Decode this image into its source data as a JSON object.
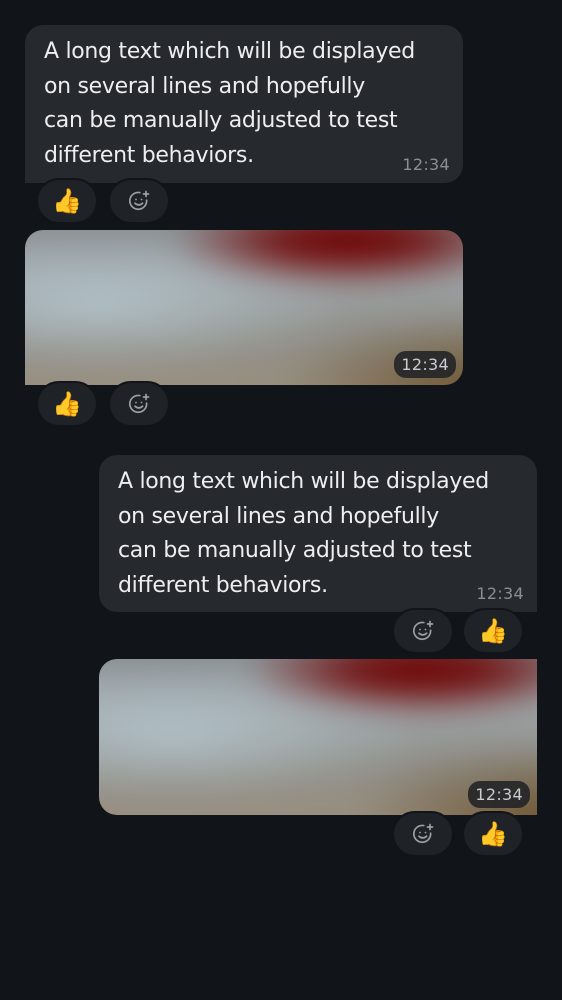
{
  "messages": [
    {
      "text": "A long text which will be displayed\non several lines and hopefully\ncan be manually adjusted to test\ndifferent behaviors.",
      "time": "12:34",
      "reaction": "👍"
    },
    {
      "time": "12:34",
      "reaction": "👍"
    },
    {
      "text": "A long text which will be displayed\non several lines and hopefully\ncan be manually adjusted to test\ndifferent behaviors.",
      "time": "12:34",
      "reaction": "👍"
    },
    {
      "time": "12:34",
      "reaction": "👍"
    }
  ],
  "icons": {
    "add_reaction": "add-reaction-icon"
  },
  "colors": {
    "background": "#111418",
    "bubble": "#26292e",
    "text": "#eceef0",
    "timestamp": "#8a8f95"
  }
}
